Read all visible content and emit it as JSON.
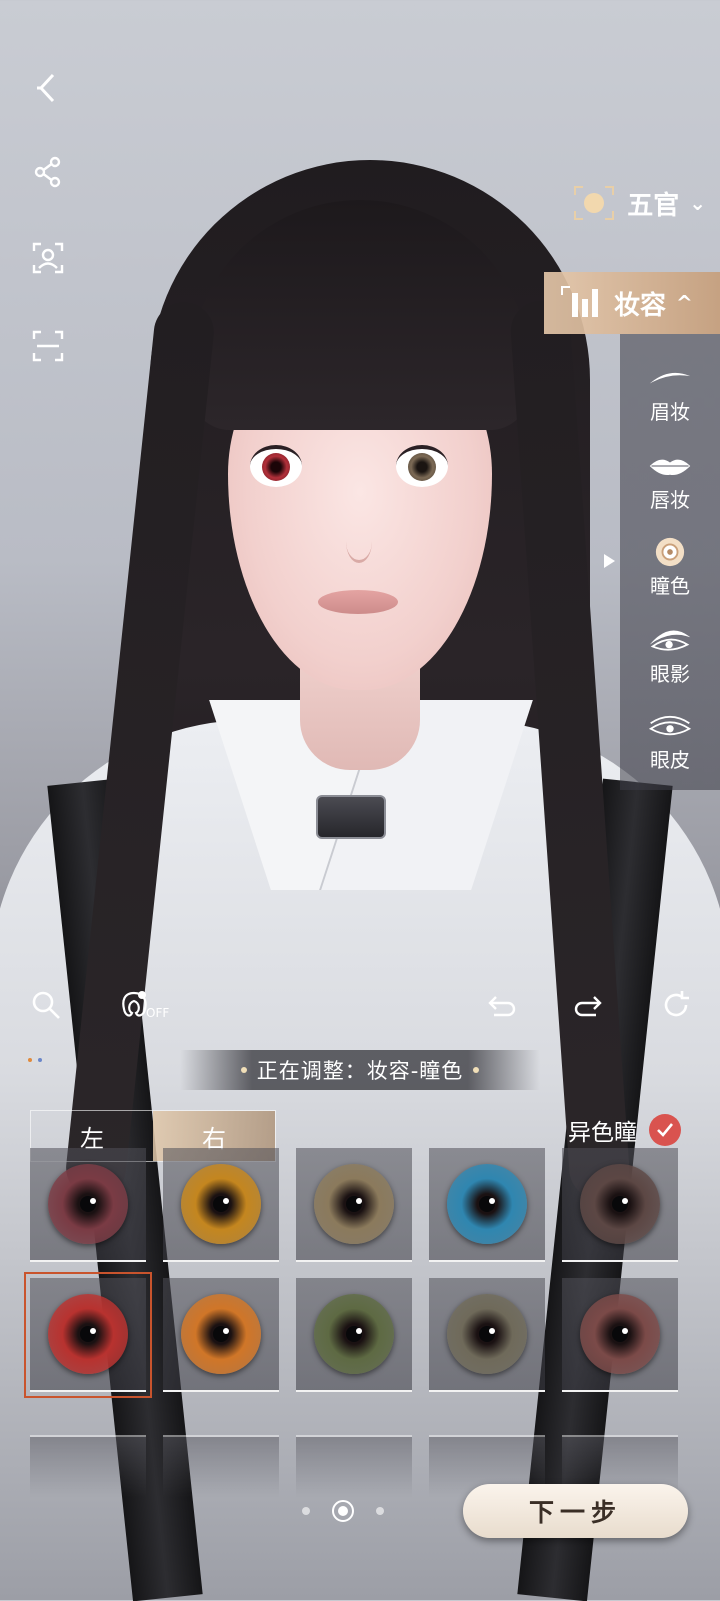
{
  "categories": {
    "features_label": "五官",
    "features_chevron": "⌄",
    "makeup_label": "妆容",
    "makeup_chevron": "^"
  },
  "makeup_items": [
    {
      "label": "眉妆",
      "icon": "eyebrow-icon"
    },
    {
      "label": "唇妆",
      "icon": "lips-icon"
    },
    {
      "label": "瞳色",
      "icon": "pupil-icon",
      "selected": true
    },
    {
      "label": "眼影",
      "icon": "eyeshadow-icon"
    },
    {
      "label": "眼皮",
      "icon": "eyelid-icon"
    }
  ],
  "toolbar": {
    "off_label": "OFF"
  },
  "status": {
    "adjusting_text": "正在调整：妆容-瞳色"
  },
  "side_toggle": {
    "left": "左",
    "right": "右",
    "active": "右"
  },
  "heterochromia": {
    "label": "异色瞳",
    "checked": true
  },
  "swatches": [
    {
      "color": "#7a3b44",
      "selected": false
    },
    {
      "color": "#c4861f",
      "selected": false
    },
    {
      "color": "#8b7a5c",
      "selected": false
    },
    {
      "color": "#2f86b0",
      "selected": false
    },
    {
      "color": "#5c4744",
      "selected": false
    },
    {
      "color": "#b8322f",
      "selected": true
    },
    {
      "color": "#d07628",
      "selected": false
    },
    {
      "color": "#5e6a43",
      "selected": false
    },
    {
      "color": "#6f6a5a",
      "selected": false
    },
    {
      "color": "#7b4a48",
      "selected": false
    }
  ],
  "next_button": "下一步",
  "colors": {
    "accent": "#d9534f",
    "gold": "#e6c8aa",
    "selected_outline": "#c9542d"
  }
}
